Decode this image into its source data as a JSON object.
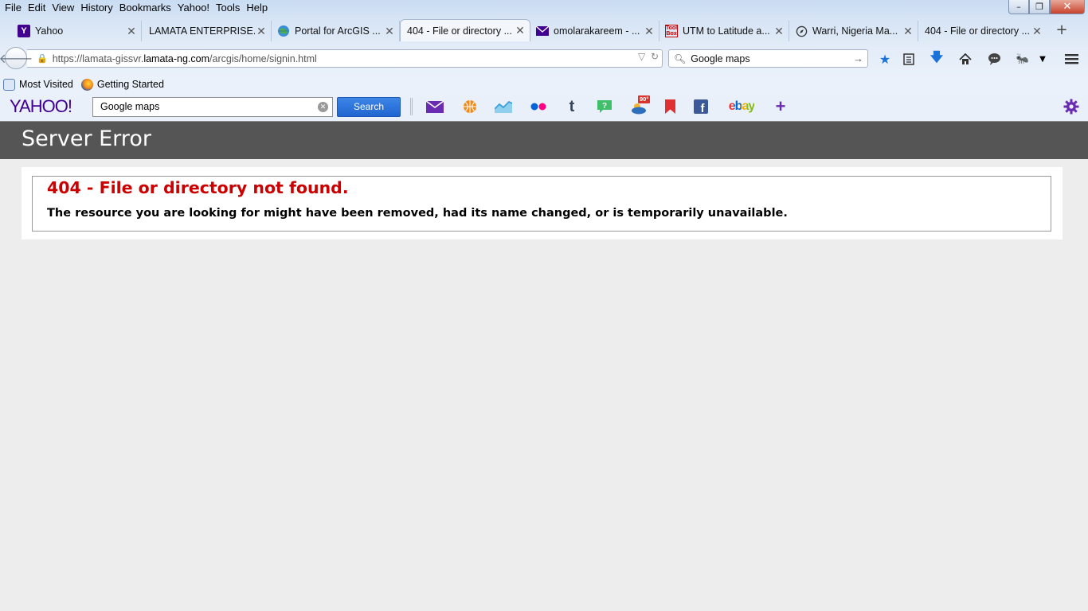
{
  "menubar": {
    "items": [
      "File",
      "Edit",
      "View",
      "History",
      "Bookmarks",
      "Yahoo!",
      "Tools",
      "Help"
    ]
  },
  "window_controls": {
    "minimize": "–",
    "maximize": "❐",
    "close": "✕"
  },
  "tabs": [
    {
      "title": "Yahoo",
      "close": "✕"
    },
    {
      "title": "LAMATA ENTERPRISE...",
      "close": "✕"
    },
    {
      "title": "Portal for ArcGIS ...",
      "close": "✕"
    },
    {
      "title": "404 - File or directory ...",
      "close": "✕"
    },
    {
      "title": "omolarakareem - ...",
      "close": "✕"
    },
    {
      "title": "UTM to Latitude a...",
      "close": "✕"
    },
    {
      "title": "Warri, Nigeria Ma...",
      "close": "✕"
    },
    {
      "title": "404 - File or directory ...",
      "close": "✕"
    }
  ],
  "new_tab": "+",
  "navbar": {
    "url_prefix": "https://lamata-gissvr.",
    "url_host": "lamata-ng.com",
    "url_suffix": "/arcgis/home/signin.html",
    "search_value": "Google maps"
  },
  "bookmarks": [
    {
      "label": "Most Visited"
    },
    {
      "label": "Getting Started"
    }
  ],
  "yahoo_toolbar": {
    "logo": "YAHOO!",
    "search_value": "Google maps",
    "search_button": "Search",
    "weather_badge": "90°",
    "ebay_label": "ebay"
  },
  "page": {
    "header": "Server Error",
    "error_title": "404 - File or directory not found.",
    "error_message": "The resource you are looking for might have been removed, had its name changed, or is temporarily unavailable."
  },
  "colors": {
    "error_red": "#cc0000",
    "header_gray": "#555555",
    "yahoo_purple": "#400090",
    "search_blue": "#1f65d0"
  }
}
